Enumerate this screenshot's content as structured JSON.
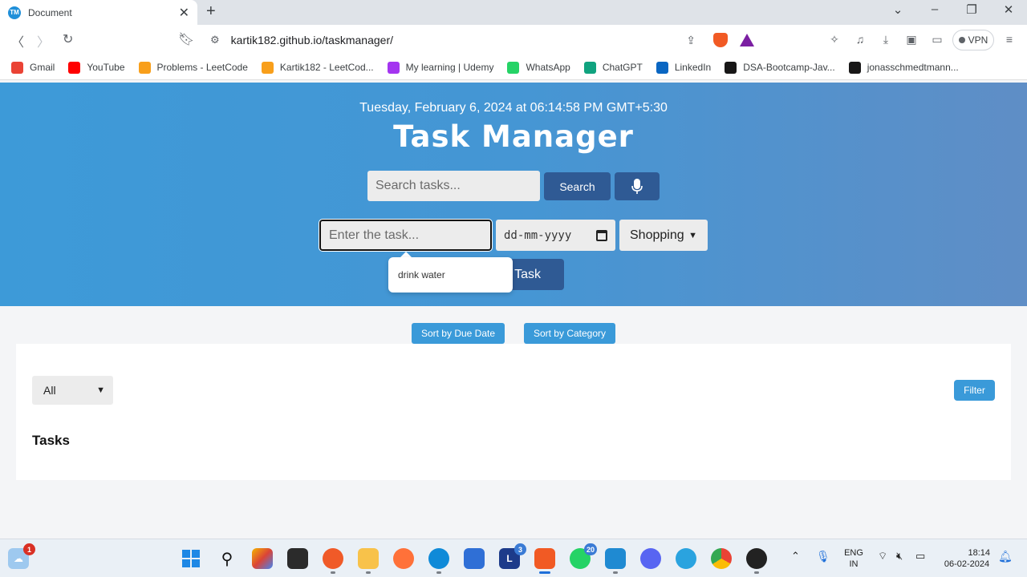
{
  "browser": {
    "tab_title": "Document",
    "tab_favicon": "TM",
    "address": "kartik182.github.io/taskmanager/",
    "vpn_label": "VPN",
    "bookmarks": [
      {
        "label": "Gmail",
        "color": "#ea4335",
        "icon": "gmail-icon"
      },
      {
        "label": "YouTube",
        "color": "#ff0000",
        "icon": "youtube-icon"
      },
      {
        "label": "Problems - LeetCode",
        "color": "#f89f1b",
        "icon": "leetcode-icon"
      },
      {
        "label": "Kartik182 - LeetCod...",
        "color": "#f89f1b",
        "icon": "leetcode-icon"
      },
      {
        "label": "My learning | Udemy",
        "color": "#a435f0",
        "icon": "udemy-icon"
      },
      {
        "label": "WhatsApp",
        "color": "#25d366",
        "icon": "whatsapp-icon"
      },
      {
        "label": "ChatGPT",
        "color": "#10a37f",
        "icon": "chatgpt-icon"
      },
      {
        "label": "LinkedIn",
        "color": "#0a66c2",
        "icon": "linkedin-icon"
      },
      {
        "label": "DSA-Bootcamp-Jav...",
        "color": "#181717",
        "icon": "github-icon"
      },
      {
        "label": "jonasschmedtmann...",
        "color": "#181717",
        "icon": "github-icon"
      }
    ]
  },
  "header": {
    "datetime": "Tuesday, February 6, 2024 at 06:14:58 PM GMT+5:30",
    "title": "Task Manager"
  },
  "search": {
    "placeholder": "Search tasks...",
    "button_label": "Search"
  },
  "form": {
    "task_placeholder": "Enter the task...",
    "date_placeholder": "dd-mm-yyyy",
    "category_selected": "Shopping",
    "add_button_label": "Task",
    "autocomplete_suggestion": "drink water"
  },
  "sorting": {
    "by_due_date": "Sort by Due Date",
    "by_category": "Sort by Category"
  },
  "task_panel": {
    "filter_selected": "All",
    "filter_button": "Filter",
    "heading": "Tasks"
  },
  "taskbar": {
    "weather_badge": "1",
    "lichess_badge": "3",
    "whatsapp_badge": "20",
    "lang_line1": "ENG",
    "lang_line2": "IN",
    "time": "18:14",
    "date": "06-02-2024"
  },
  "colors": {
    "hero_gradient_start": "#3d9ad8",
    "hero_gradient_end": "#5f8ec6",
    "primary_dark_button": "#2f5a94",
    "accent_button": "#3a9ad9"
  }
}
